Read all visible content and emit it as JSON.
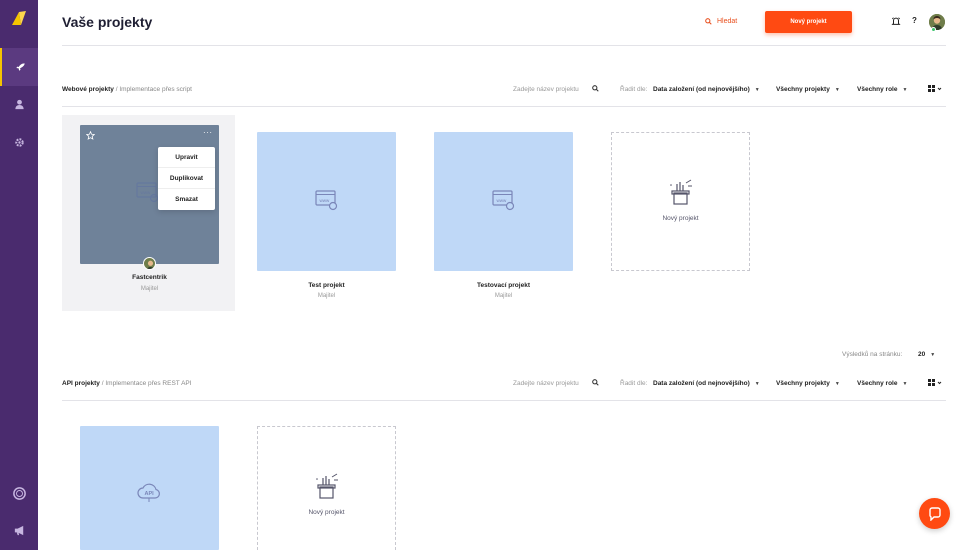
{
  "app": {
    "title": "Vaše projekty"
  },
  "header": {
    "search_label": "Hledat",
    "new_project_label": "Nový projekt"
  },
  "sidebar": {
    "items": [
      {
        "icon": "rocket-icon",
        "active": true
      },
      {
        "icon": "user-icon",
        "active": false
      },
      {
        "icon": "gear-icon",
        "active": false
      }
    ],
    "bottom": [
      {
        "icon": "help-ring-icon"
      },
      {
        "icon": "megaphone-icon"
      }
    ]
  },
  "sections": [
    {
      "title": "Webové projekty",
      "subtitle": " / Implementace přes script",
      "search_placeholder": "Zadejte název projektu",
      "sort_label": "Řadit dle:",
      "sort_value": "Data založení (od nejnovějšího)",
      "filter_all": "Všechny projekty",
      "filter_roles": "Všechny role",
      "projects": [
        {
          "name": "Fastcentrik",
          "role": "Majitel"
        },
        {
          "name": "Test projekt",
          "role": "Majitel"
        },
        {
          "name": "Testovací projekt",
          "role": "Majitel"
        }
      ],
      "new_card_label": "Nový projekt"
    },
    {
      "title": "API projekty",
      "subtitle": " / Implementace přes REST API",
      "search_placeholder": "Zadejte název projektu",
      "sort_label": "Řadit dle:",
      "sort_value": "Data založení (od nejnovějšího)",
      "filter_all": "Všechny projekty",
      "filter_roles": "Všechny role",
      "api_badge": "API",
      "new_card_label": "Nový projekt"
    }
  ],
  "context_menu": [
    "Upravit",
    "Duplikovat",
    "Smazat"
  ],
  "pagination": {
    "label": "Výsledků na stránku:",
    "value": "20"
  },
  "colors": {
    "sidebar": "#4a2b6e",
    "accent": "#ff4a12",
    "thumb": "#bfd8f7"
  }
}
